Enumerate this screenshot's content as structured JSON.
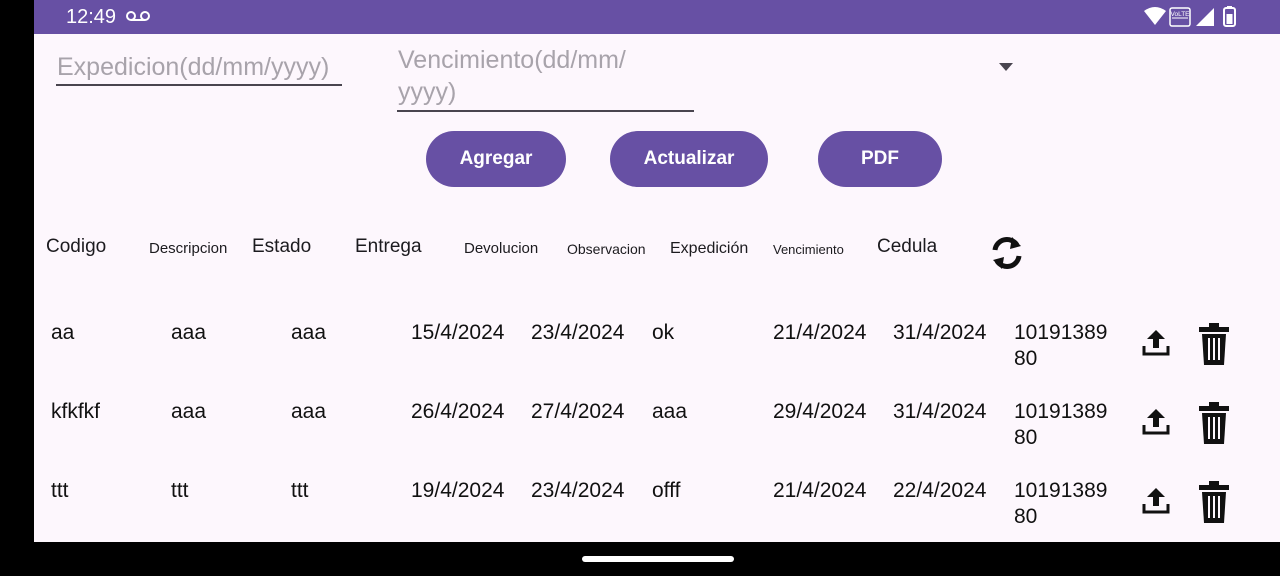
{
  "status": {
    "time": "12:49",
    "network_badge": "VoLTE"
  },
  "form": {
    "expedicion_placeholder": "Expedicion(dd/mm/yyyy)",
    "vencimiento_placeholder_line1": "Vencimiento(dd/mm/",
    "vencimiento_placeholder_line2": "yyyy)"
  },
  "buttons": {
    "agregar": "Agregar",
    "actualizar": "Actualizar",
    "pdf": "PDF"
  },
  "table": {
    "headers": [
      "Codigo",
      "Descripcion",
      "Estado",
      "Entrega",
      "Devolucion",
      "Observacion",
      "Expedición",
      "Vencimiento",
      "Cedula"
    ],
    "rows": [
      {
        "codigo": "aa",
        "descripcion": "aaa",
        "estado": "aaa",
        "entrega": "15/4/2024",
        "devolucion": "23/4/2024",
        "observacion": "ok",
        "expedicion": "21/4/2024",
        "vencimiento": "31/4/2024",
        "cedula1": "10191389",
        "cedula2": "80"
      },
      {
        "codigo": "kfkfkf",
        "descripcion": "aaa",
        "estado": "aaa",
        "entrega": "26/4/2024",
        "devolucion": "27/4/2024",
        "observacion": "aaa",
        "expedicion": "29/4/2024",
        "vencimiento": "31/4/2024",
        "cedula1": "10191389",
        "cedula2": "80"
      },
      {
        "codigo": "ttt",
        "descripcion": "ttt",
        "estado": "ttt",
        "entrega": "19/4/2024",
        "devolucion": "23/4/2024",
        "observacion": "offf",
        "expedicion": "21/4/2024",
        "vencimiento": "22/4/2024",
        "cedula1": "10191389",
        "cedula2": "80"
      }
    ]
  },
  "icons": {
    "refresh": "refresh-icon",
    "upload": "upload-icon",
    "delete": "trash-icon",
    "dropdown": "caret-down-icon"
  },
  "colors": {
    "primary": "#6750a4",
    "background": "#fdf7fd"
  }
}
